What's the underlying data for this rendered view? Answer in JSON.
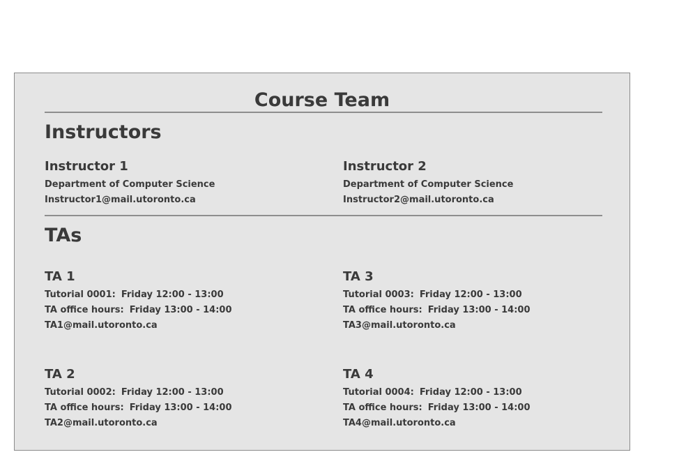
{
  "title": "Course Team",
  "instructors": {
    "heading": "Instructors",
    "items": [
      {
        "name": "Instructor 1",
        "department": "Department of Computer Science",
        "email": "Instructor1@mail.utoronto.ca"
      },
      {
        "name": "Instructor 2",
        "department": "Department of Computer Science",
        "email": "Instructor2@mail.utoronto.ca"
      }
    ]
  },
  "tas": {
    "heading": "TAs",
    "items": [
      {
        "name": "TA 1",
        "tutorial_label": "Tutorial 0001:",
        "tutorial_time": "Friday 12:00 - 13:00",
        "office_label": "TA office hours:",
        "office_time": "Friday 13:00 - 14:00",
        "email": "TA1@mail.utoronto.ca"
      },
      {
        "name": "TA 3",
        "tutorial_label": "Tutorial 0003:",
        "tutorial_time": "Friday 12:00 - 13:00",
        "office_label": "TA office hours:",
        "office_time": "Friday 13:00 - 14:00",
        "email": "TA3@mail.utoronto.ca"
      },
      {
        "name": "TA 2",
        "tutorial_label": "Tutorial 0002:",
        "tutorial_time": "Friday 12:00 - 13:00",
        "office_label": "TA office hours:",
        "office_time": "Friday 13:00 - 14:00",
        "email": "TA2@mail.utoronto.ca"
      },
      {
        "name": "TA 4",
        "tutorial_label": "Tutorial 0004:",
        "tutorial_time": "Friday 12:00 - 13:00",
        "office_label": "TA office hours:",
        "office_time": "Friday 13:00 - 14:00",
        "email": "TA4@mail.utoronto.ca"
      }
    ]
  }
}
